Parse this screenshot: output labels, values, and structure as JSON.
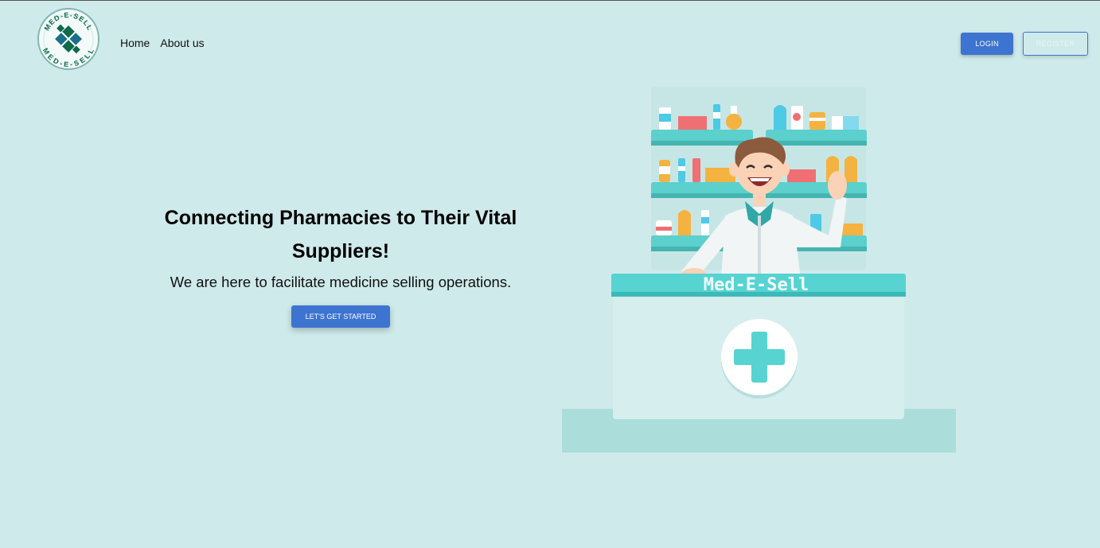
{
  "logo": {
    "text_top": "MED-E-SELL",
    "text_bottom": "MED-E-SELL"
  },
  "nav": {
    "home": "Home",
    "about": "About us"
  },
  "auth": {
    "login": "LOGIN",
    "register": "REGISTER"
  },
  "hero": {
    "headline": "Connecting Pharmacies to Their Vital Suppliers!",
    "subtext": "We are here to facilitate medicine selling operations.",
    "cta": "LET'S GET STARTED"
  },
  "illustration": {
    "counter_sign": "Med-E-Sell"
  },
  "colors": {
    "background": "#cfeaeb",
    "primary": "#3d74cf",
    "teal": "#57d3d2",
    "logo_green": "#0f6a4a",
    "logo_blue": "#1a6f8a"
  }
}
